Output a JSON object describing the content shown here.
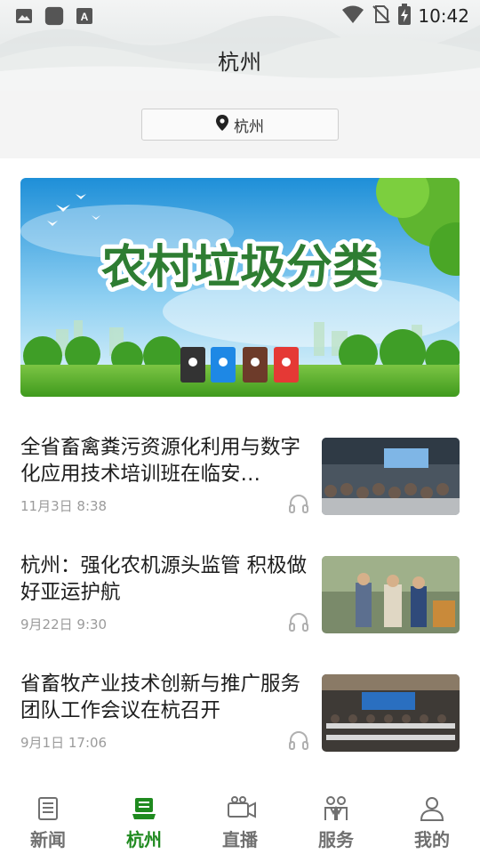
{
  "status_bar": {
    "time": "10:42",
    "left_icons": [
      "image-icon",
      "app-square-icon",
      "font-icon"
    ],
    "right_icons": [
      "wifi-icon",
      "no-sim-icon",
      "battery-charging-icon"
    ]
  },
  "header": {
    "title": "杭州"
  },
  "location": {
    "label": "杭州",
    "icon": "location-pin-icon"
  },
  "banner": {
    "text": "农村垃圾分类"
  },
  "news": [
    {
      "title": "全省畜禽粪污资源化利用与数字化应用技术培训班在临安…",
      "time": "11月3日  8:38"
    },
    {
      "title": "杭州：强化农机源头监管  积极做好亚运护航",
      "time": "9月22日  9:30"
    },
    {
      "title": "省畜牧产业技术创新与推广服务团队工作会议在杭召开",
      "time": "9月1日  17:06"
    }
  ],
  "tabs": [
    {
      "label": "新闻",
      "icon": "newspaper-icon",
      "active": false
    },
    {
      "label": "杭州",
      "icon": "laptop-news-icon",
      "active": true
    },
    {
      "label": "直播",
      "icon": "video-camera-icon",
      "active": false
    },
    {
      "label": "服务",
      "icon": "service-people-icon",
      "active": false
    },
    {
      "label": "我的",
      "icon": "user-icon",
      "active": false
    }
  ],
  "colors": {
    "accent": "#1f8a1f",
    "inactive": "#707070",
    "banner_text": "#2e7d32"
  }
}
